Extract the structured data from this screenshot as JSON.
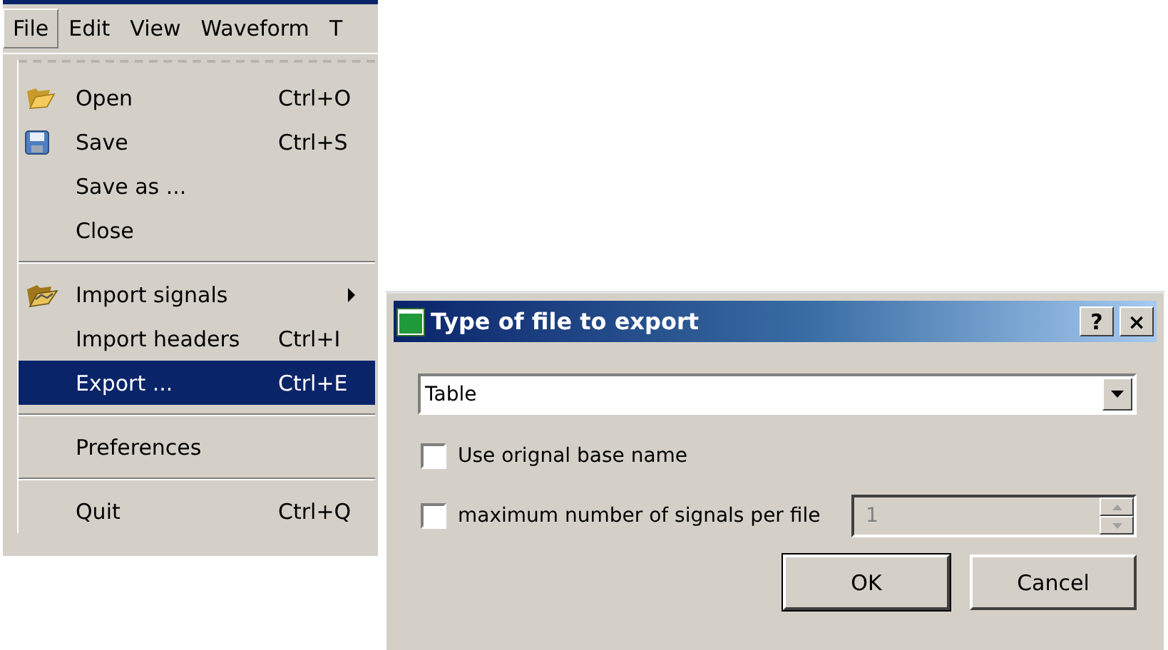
{
  "menubar": [
    {
      "label": "File",
      "selected": true
    },
    {
      "label": "Edit",
      "selected": false
    },
    {
      "label": "View",
      "selected": false
    },
    {
      "label": "Waveform",
      "selected": false
    },
    {
      "label": "T",
      "selected": false
    }
  ],
  "menu": [
    {
      "kind": "tearoff"
    },
    {
      "kind": "command",
      "label": "Open",
      "shortcut": "Ctrl+O",
      "selected": false
    },
    {
      "kind": "command",
      "label": "Save",
      "shortcut": "Ctrl+S",
      "selected": false
    },
    {
      "kind": "command",
      "label": "Save as ...",
      "selected": false
    },
    {
      "kind": "command",
      "label": "Close",
      "selected": false
    },
    {
      "kind": "separator"
    },
    {
      "kind": "submenu",
      "label": "Import signals",
      "selected": false
    },
    {
      "kind": "command",
      "label": "Import headers",
      "shortcut": "Ctrl+I",
      "selected": false
    },
    {
      "kind": "command",
      "label": "Export ...",
      "shortcut": "Ctrl+E",
      "selected": true
    },
    {
      "kind": "separator"
    },
    {
      "kind": "command",
      "label": "Preferences",
      "selected": false
    },
    {
      "kind": "separator"
    },
    {
      "kind": "command",
      "label": "Quit",
      "shortcut": "Ctrl+Q",
      "selected": false
    }
  ],
  "dialog": {
    "title": "Type of file to export",
    "help": "?",
    "close": "×",
    "file_type": {
      "value": "Table"
    },
    "options": [
      {
        "label": "Use orignal base name",
        "checked": false
      },
      {
        "label": "maximum number of signals per file",
        "checked": false,
        "spin": {
          "value": "1",
          "disabled": true
        }
      }
    ],
    "buttons": [
      "OK",
      "Cancel"
    ]
  }
}
